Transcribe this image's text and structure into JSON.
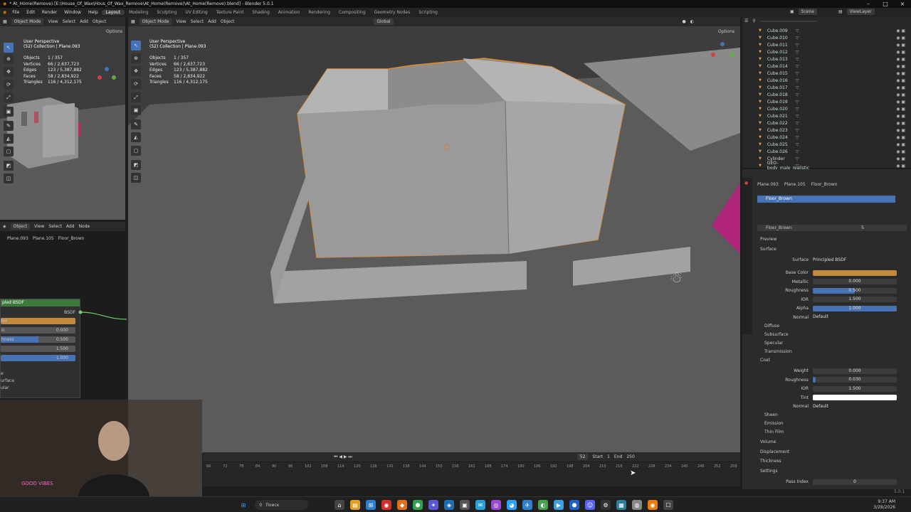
{
  "titlebar": {
    "title": "* At_Home(Remove) [E:\\House_Of_Wax\\Hous_Of_Wax_Remove\\At_Home(Remove)\\At_Home(Remove).blend] - Blender 5.0.1"
  },
  "menu": {
    "items": [
      "File",
      "Edit",
      "Render",
      "Window",
      "Help"
    ],
    "workspaces": [
      "Layout",
      "Modeling",
      "Sculpting",
      "UV Editing",
      "Texture Paint",
      "Shading",
      "Animation",
      "Rendering",
      "Compositing",
      "Geometry Nodes",
      "Scripting"
    ],
    "active_workspace": "Layout",
    "scene": "Scene",
    "view_layer": "ViewLayer"
  },
  "viewport_small": {
    "mode": "Object Mode",
    "menus": [
      "View",
      "Select",
      "Add",
      "Object"
    ],
    "options": "Options",
    "perspective": "User Perspective",
    "collection": "(52) Collection | Plane.093",
    "stats": [
      {
        "k": "Objects",
        "v": "1 / 357"
      },
      {
        "k": "Vertices",
        "v": "66 / 2,637,723"
      },
      {
        "k": "Edges",
        "v": "123 / 5,387,882"
      },
      {
        "k": "Faces",
        "v": "58 / 2,834,922"
      },
      {
        "k": "Triangles",
        "v": "116 / 4,312,175"
      }
    ]
  },
  "viewport_main": {
    "mode": "Object Mode",
    "menus": [
      "View",
      "Select",
      "Add",
      "Object"
    ],
    "transform": "Global",
    "options": "Options",
    "perspective": "User Perspective",
    "collection": "(52) Collection | Plane.093",
    "stats": [
      {
        "k": "Objects",
        "v": "1 / 357"
      },
      {
        "k": "Vertices",
        "v": "66 / 2,637,723"
      },
      {
        "k": "Edges",
        "v": "123 / 5,387,882"
      },
      {
        "k": "Faces",
        "v": "58 / 2,834,922"
      },
      {
        "k": "Triangles",
        "v": "116 / 4,312,175"
      }
    ]
  },
  "node_editor": {
    "mode": "Object",
    "menus": [
      "View",
      "Select",
      "Add",
      "Node"
    ],
    "breadcrumb": [
      "Plane.093",
      "Plane.105",
      "Floor_Brown"
    ],
    "node_title": "pled BSDF",
    "bsdf": "BSDF",
    "rows": [
      {
        "l": "lor",
        "v": ""
      },
      {
        "l": "ic",
        "v": "0.000"
      },
      {
        "l": "hness",
        "v": "0.500"
      },
      {
        "l": "",
        "v": "1.500"
      },
      {
        "l": "",
        "v": "1.000"
      }
    ],
    "extra": [
      "e",
      "urface",
      "ular"
    ]
  },
  "outliner": {
    "search_placeholder": "",
    "items": [
      "Cube.009",
      "Cube.010",
      "Cube.011",
      "Cube.012",
      "Cube.013",
      "Cube.014",
      "Cube.015",
      "Cube.016",
      "Cube.017",
      "Cube.018",
      "Cube.019",
      "Cube.020",
      "Cube.021",
      "Cube.022",
      "Cube.023",
      "Cube.024",
      "Cube.025",
      "Cube.026",
      "Cylinder",
      "GEO-body_male_realistic"
    ]
  },
  "properties": {
    "breadcrumb": [
      "Plane.093",
      "Plane.105",
      "Floor_Brown"
    ],
    "material_slot": "Floor_Brown",
    "material_name": "Floor_Brown",
    "users": "5",
    "preview": "Preview",
    "surface_section": "Surface",
    "surface": "Principled BSDF",
    "main_rows": [
      {
        "l": "Base Color",
        "v": "",
        "color": "#c48a3c"
      },
      {
        "l": "Metallic",
        "v": "0.000",
        "fill": 0
      },
      {
        "l": "Roughness",
        "v": "0.500",
        "fill": 0.5
      },
      {
        "l": "IOR",
        "v": "1.500",
        "fill": 0
      },
      {
        "l": "Alpha",
        "v": "1.000",
        "fill": 1
      },
      {
        "l": "Normal",
        "v": "Default"
      }
    ],
    "subsections": [
      "Diffuse",
      "Subsurface",
      "Specular",
      "Transmission"
    ],
    "coat_section": "Coat",
    "coat_rows": [
      {
        "l": "Weight",
        "v": "0.000",
        "fill": 0
      },
      {
        "l": "Roughness",
        "v": "0.030",
        "fill": 0.03
      },
      {
        "l": "IOR",
        "v": "1.500",
        "fill": 0
      },
      {
        "l": "Tint",
        "v": "",
        "color": "#ffffff"
      },
      {
        "l": "Normal",
        "v": "Default"
      }
    ],
    "more": [
      "Sheen",
      "Emission",
      "Thin Film"
    ],
    "volume": [
      "Volume",
      "Displacement",
      "Thickness",
      "Settings"
    ],
    "pass_index_label": "Pass Index",
    "pass_index": "0"
  },
  "timeline": {
    "current": "52",
    "start_label": "Start",
    "start": "1",
    "end_label": "End",
    "end": "250",
    "ticks": [
      "66",
      "72",
      "78",
      "84",
      "90",
      "96",
      "102",
      "108",
      "114",
      "120",
      "126",
      "132",
      "138",
      "144",
      "150",
      "156",
      "162",
      "168",
      "174",
      "180",
      "186",
      "192",
      "198",
      "204",
      "210",
      "216",
      "222",
      "228",
      "234",
      "240",
      "246",
      "252",
      "258"
    ]
  },
  "status": {
    "version": "5.0.1"
  },
  "taskbar": {
    "search": "Поиск",
    "time": "9:37 AM",
    "date": "3/28/2026"
  },
  "webcam": {
    "sign": "GOOD VIBES ONLY"
  },
  "colors": {
    "accent": "#4772b3",
    "select_orange": "#e08a2c",
    "base_color": "#c48a3c"
  }
}
